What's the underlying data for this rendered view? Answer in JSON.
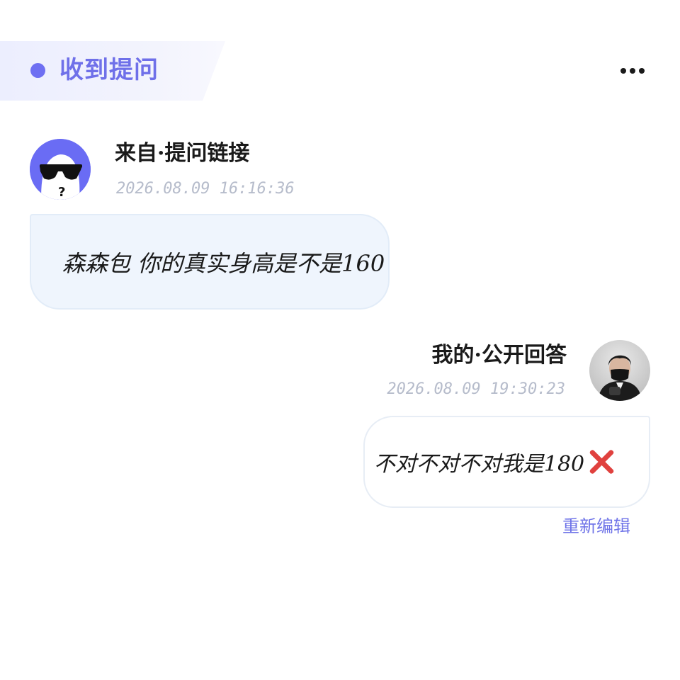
{
  "header": {
    "title": "收到提问",
    "more_icon": "more-horizontal-icon",
    "accent_color": "#6e6ff2"
  },
  "question": {
    "avatar_icon": "sunglasses-ghost-avatar",
    "source_label": "来自·提问链接",
    "timestamp": "2026.08.09 16:16:36",
    "text": "森森包 你的真实身高是不是160"
  },
  "answer": {
    "avatar_icon": "user-photo-avatar",
    "label": "我的·公开回答",
    "timestamp": "2026.08.09 19:30:23",
    "text": "不对不对不对我是180",
    "trailing_icon": "red-cross-mark-icon",
    "reedit_label": "重新编辑"
  }
}
